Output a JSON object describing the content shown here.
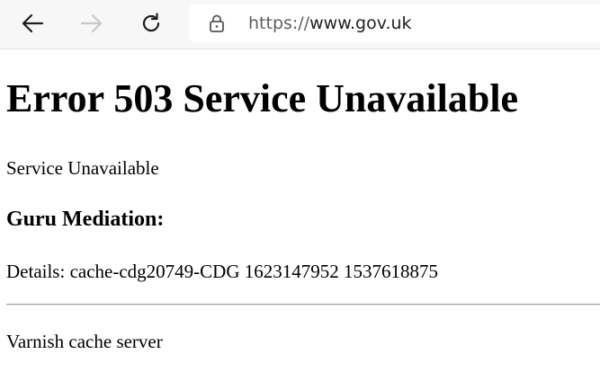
{
  "browser": {
    "url_scheme": "https://",
    "url_host": "www.gov.uk",
    "icons": {
      "back": "arrow-left-icon",
      "forward": "arrow-right-icon",
      "refresh": "refresh-icon",
      "lock": "lock-icon"
    },
    "colors": {
      "toolbar_bg": "#f7f7f7",
      "forward_disabled": "#c8c8c8"
    }
  },
  "page": {
    "heading": "Error 503 Service Unavailable",
    "message": "Service Unavailable",
    "subheading": "Guru Mediation:",
    "details": "Details: cache-cdg20749-CDG 1623147952 1537618875",
    "footer": "Varnish cache server"
  }
}
